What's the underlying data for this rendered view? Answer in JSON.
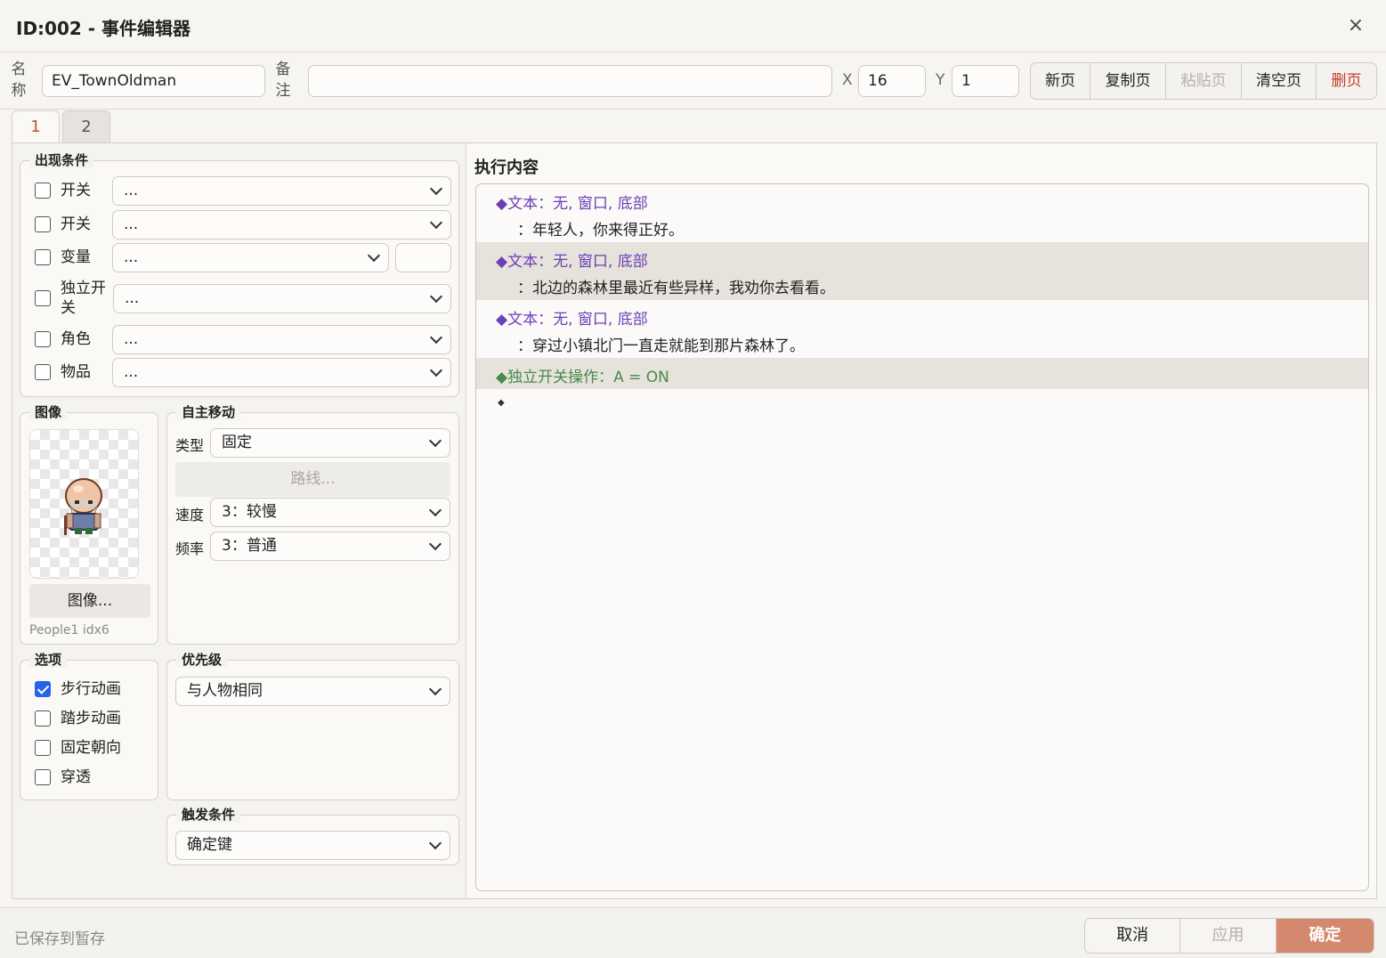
{
  "window": {
    "title": "ID:002 - 事件编辑器",
    "close_glyph": "×"
  },
  "top": {
    "name_label": [
      "名",
      "称"
    ],
    "name_value": "EV_TownOldman",
    "note_label": [
      "备",
      "注"
    ],
    "note_value": "",
    "x_label": "X",
    "x_value": "16",
    "y_label": "Y",
    "y_value": "1",
    "page_buttons": [
      "新页",
      "复制页",
      "粘贴页",
      "清空页",
      "删页"
    ]
  },
  "tabs": [
    "1",
    "2"
  ],
  "conditions": {
    "legend": "出现条件",
    "rows": [
      {
        "label": "开关",
        "value": "..."
      },
      {
        "label": "开关",
        "value": "..."
      },
      {
        "label": "变量",
        "value": "..."
      },
      {
        "label": "独立开关",
        "value": "..."
      },
      {
        "label": "角色",
        "value": "..."
      },
      {
        "label": "物品",
        "value": "..."
      }
    ],
    "var_value": ""
  },
  "image": {
    "legend": "图像",
    "button": "图像...",
    "caption": "People1 idx6"
  },
  "autonomous": {
    "legend": "自主移动",
    "type_label": "类型",
    "type_value": "固定",
    "route_button": "路线...",
    "speed_label": "速度",
    "speed_value": "3：较慢",
    "freq_label": "频率",
    "freq_value": "3：普通"
  },
  "options": {
    "legend": "选项",
    "items": [
      {
        "label": "步行动画",
        "checked": true
      },
      {
        "label": "踏步动画",
        "checked": false
      },
      {
        "label": "固定朝向",
        "checked": false
      },
      {
        "label": "穿透",
        "checked": false
      }
    ]
  },
  "priority": {
    "legend": "优先级",
    "value": "与人物相同"
  },
  "trigger": {
    "legend": "触发条件",
    "value": "确定键"
  },
  "contents": {
    "title": "执行内容",
    "commands": [
      {
        "head": "◆文本：无, 窗口, 底部",
        "body": "：年轻人，你来得正好。"
      },
      {
        "head": "◆文本：无, 窗口, 底部",
        "body": "：北边的森林里最近有些异样，我劝你去看看。"
      },
      {
        "head": "◆文本：无, 窗口, 底部",
        "body": "：穿过小镇北门一直走就能到那片森林了。"
      },
      {
        "head": "◆独立开关操作：A = ON",
        "body": ""
      }
    ],
    "end_marker": "◆"
  },
  "footer": {
    "status": "已保存到暂存",
    "buttons": [
      "取消",
      "应用",
      "确定"
    ]
  },
  "colors": {
    "accent": "#d4896f",
    "command_text": "#6c3fb8",
    "switch_text": "#4a8a4a",
    "danger": "#c0392b"
  }
}
